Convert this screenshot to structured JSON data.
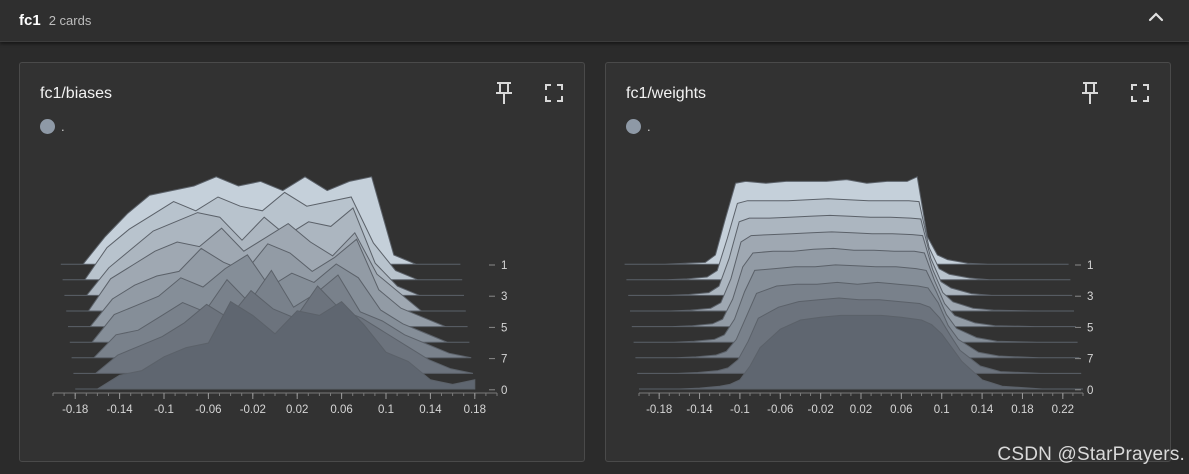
{
  "group": {
    "title": "fc1",
    "count": "2 cards"
  },
  "cards": [
    {
      "title": "fc1/biases",
      "legend_label": ".",
      "chart_data": {
        "type": "area",
        "subtype": "ridgeline-histogram",
        "xlim": [
          -0.2,
          0.2
        ],
        "x_ticks": [
          "-0.18",
          "-0.14",
          "-0.1",
          "-0.06",
          "-0.02",
          "0.02",
          "0.06",
          "0.1",
          "0.14",
          "0.18"
        ],
        "step_ticks": [
          "1",
          "3",
          "5",
          "7",
          "0"
        ],
        "x": [
          -0.18,
          -0.16,
          -0.14,
          -0.12,
          -0.1,
          -0.08,
          -0.06,
          -0.04,
          -0.02,
          0,
          0.02,
          0.04,
          0.06,
          0.08,
          0.1,
          0.12,
          0.14,
          0.16,
          0.18
        ],
        "series": [
          {
            "step": 0,
            "values": [
              0,
              0,
              0.15,
              0.2,
              0.35,
              0.45,
              0.5,
              0.95,
              0.8,
              0.6,
              0.85,
              0.8,
              0.95,
              0.7,
              0.4,
              0.3,
              0.1,
              0.05,
              0.1
            ]
          },
          {
            "step": 1,
            "values": [
              0,
              0,
              0.2,
              0.3,
              0.4,
              0.55,
              0.75,
              0.6,
              0.9,
              0.7,
              0.6,
              0.95,
              0.7,
              0.6,
              0.45,
              0.3,
              0.15,
              0.05,
              0
            ]
          },
          {
            "step": 2,
            "values": [
              0,
              0,
              0.25,
              0.3,
              0.45,
              0.6,
              0.5,
              0.85,
              0.6,
              0.95,
              0.55,
              0.7,
              0.9,
              0.5,
              0.4,
              0.25,
              0.15,
              0.05,
              0
            ]
          },
          {
            "step": 3,
            "values": [
              0,
              0,
              0.3,
              0.4,
              0.5,
              0.7,
              0.6,
              0.8,
              0.95,
              0.6,
              0.75,
              0.65,
              0.85,
              0.7,
              0.35,
              0.2,
              0.1,
              0,
              0
            ]
          },
          {
            "step": 4,
            "values": [
              0,
              0,
              0.3,
              0.45,
              0.55,
              0.6,
              0.85,
              0.7,
              0.6,
              0.9,
              0.8,
              0.6,
              0.75,
              0.95,
              0.4,
              0.2,
              0.1,
              0,
              0
            ]
          },
          {
            "step": 5,
            "values": [
              0,
              0,
              0.35,
              0.5,
              0.65,
              0.75,
              0.7,
              0.9,
              0.65,
              0.8,
              0.95,
              0.75,
              0.6,
              0.85,
              0.4,
              0.2,
              0,
              0,
              0
            ]
          },
          {
            "step": 6,
            "values": [
              0,
              0,
              0.3,
              0.5,
              0.7,
              0.8,
              0.9,
              0.85,
              0.6,
              0.85,
              0.65,
              0.8,
              0.75,
              0.95,
              0.35,
              0.1,
              0,
              0,
              0
            ]
          },
          {
            "step": 7,
            "values": [
              0,
              0,
              0.35,
              0.55,
              0.7,
              0.85,
              0.75,
              0.9,
              0.8,
              0.75,
              0.95,
              0.8,
              0.85,
              0.9,
              0.4,
              0.1,
              0,
              0,
              0
            ]
          },
          {
            "step": 8,
            "values": [
              0,
              0,
              0.3,
              0.55,
              0.75,
              0.8,
              0.85,
              0.95,
              0.85,
              0.9,
              0.8,
              0.95,
              0.8,
              0.9,
              0.95,
              0.1,
              0,
              0,
              0
            ]
          }
        ]
      }
    },
    {
      "title": "fc1/weights",
      "legend_label": ".",
      "chart_data": {
        "type": "area",
        "subtype": "ridgeline-histogram",
        "xlim": [
          -0.2,
          0.24
        ],
        "x_ticks": [
          "-0.18",
          "-0.14",
          "-0.1",
          "-0.06",
          "-0.02",
          "0.02",
          "0.06",
          "0.1",
          "0.14",
          "0.18",
          "0.22"
        ],
        "step_ticks": [
          "1",
          "3",
          "5",
          "7",
          "0"
        ],
        "x": [
          -0.2,
          -0.16,
          -0.14,
          -0.12,
          -0.11,
          -0.1,
          -0.09,
          -0.08,
          -0.06,
          -0.04,
          -0.02,
          0,
          0.02,
          0.04,
          0.06,
          0.08,
          0.09,
          0.1,
          0.11,
          0.12,
          0.14,
          0.16,
          0.2,
          0.24
        ],
        "series": [
          {
            "step": 0,
            "values": [
              0,
              0,
              0.01,
              0.03,
              0.05,
              0.1,
              0.25,
              0.45,
              0.65,
              0.75,
              0.78,
              0.8,
              0.8,
              0.8,
              0.78,
              0.75,
              0.7,
              0.6,
              0.45,
              0.3,
              0.1,
              0.03,
              0,
              0
            ]
          },
          {
            "step": 1,
            "values": [
              0,
              0,
              0.01,
              0.03,
              0.06,
              0.15,
              0.35,
              0.6,
              0.72,
              0.78,
              0.8,
              0.82,
              0.8,
              0.8,
              0.78,
              0.76,
              0.72,
              0.6,
              0.42,
              0.25,
              0.08,
              0.02,
              0,
              0
            ]
          },
          {
            "step": 2,
            "values": [
              0,
              0,
              0.01,
              0.03,
              0.07,
              0.2,
              0.45,
              0.7,
              0.78,
              0.8,
              0.8,
              0.82,
              0.8,
              0.82,
              0.8,
              0.78,
              0.76,
              0.6,
              0.35,
              0.2,
              0.06,
              0.02,
              0,
              0
            ]
          },
          {
            "step": 3,
            "values": [
              0,
              0,
              0.01,
              0.03,
              0.08,
              0.25,
              0.55,
              0.78,
              0.8,
              0.82,
              0.82,
              0.84,
              0.83,
              0.82,
              0.82,
              0.8,
              0.78,
              0.55,
              0.3,
              0.15,
              0.05,
              0.01,
              0,
              0
            ]
          },
          {
            "step": 4,
            "values": [
              0,
              0,
              0.01,
              0.03,
              0.08,
              0.3,
              0.65,
              0.8,
              0.82,
              0.82,
              0.84,
              0.85,
              0.83,
              0.83,
              0.82,
              0.82,
              0.8,
              0.5,
              0.25,
              0.12,
              0.04,
              0.01,
              0,
              0
            ]
          },
          {
            "step": 5,
            "values": [
              0,
              0,
              0.01,
              0.03,
              0.09,
              0.35,
              0.75,
              0.82,
              0.83,
              0.84,
              0.85,
              0.86,
              0.85,
              0.84,
              0.84,
              0.83,
              0.82,
              0.45,
              0.2,
              0.1,
              0.03,
              0.01,
              0,
              0
            ]
          },
          {
            "step": 6,
            "values": [
              0,
              0,
              0.01,
              0.03,
              0.1,
              0.4,
              0.8,
              0.84,
              0.84,
              0.85,
              0.86,
              0.87,
              0.86,
              0.85,
              0.85,
              0.84,
              0.83,
              0.4,
              0.15,
              0.08,
              0.02,
              0,
              0,
              0
            ]
          },
          {
            "step": 7,
            "values": [
              0,
              0,
              0.01,
              0.03,
              0.1,
              0.45,
              0.83,
              0.86,
              0.86,
              0.86,
              0.87,
              0.88,
              0.87,
              0.86,
              0.86,
              0.86,
              0.85,
              0.35,
              0.12,
              0.06,
              0.02,
              0,
              0,
              0
            ]
          },
          {
            "step": 8,
            "values": [
              0,
              0,
              0.01,
              0.02,
              0.1,
              0.5,
              0.88,
              0.9,
              0.88,
              0.9,
              0.9,
              0.9,
              0.92,
              0.88,
              0.9,
              0.9,
              0.95,
              0.3,
              0.1,
              0.05,
              0.01,
              0,
              0,
              0
            ]
          }
        ]
      }
    }
  ],
  "watermark": "CSDN @StarPrayers.",
  "colors": {
    "background": "#2b2b2b",
    "card": "#323232",
    "front_fill": "#5f6670",
    "back_fill": "#c5d0da",
    "ridge_stroke": "#5b6169",
    "legend_dot": "#8e99a6"
  },
  "icons": {
    "collapse": "chevron-up-icon",
    "pin": "pin-icon",
    "fullscreen": "fullscreen-icon"
  }
}
